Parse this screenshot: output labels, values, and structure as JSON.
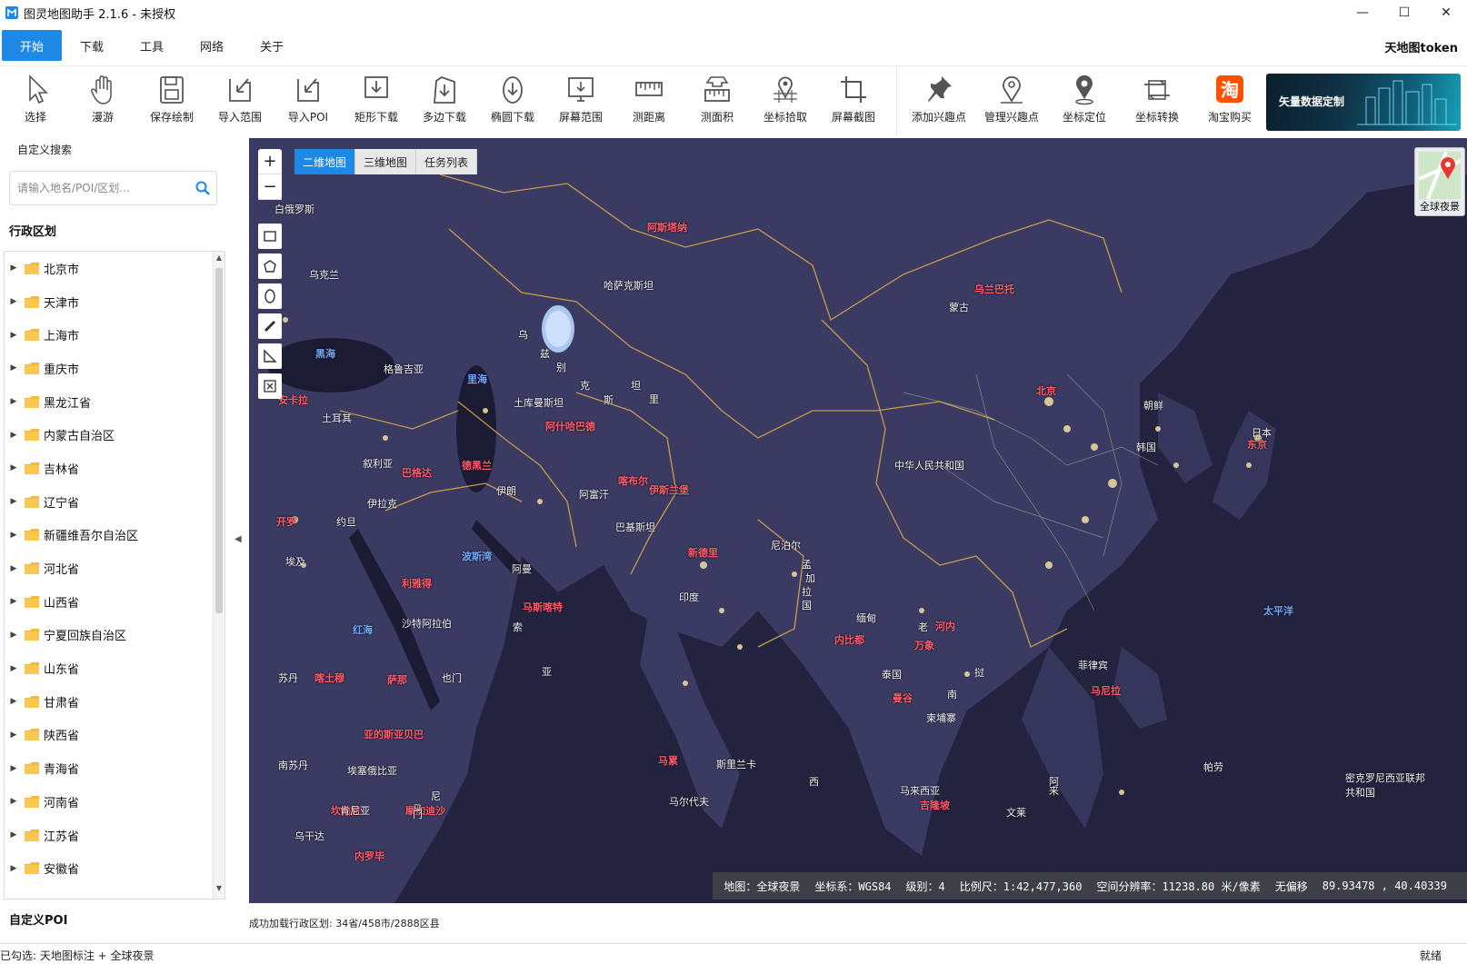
{
  "window": {
    "title": "图灵地图助手  2.1.6 - 未授权",
    "controls": {
      "minimize": "—",
      "maximize": "☐",
      "close": "✕"
    }
  },
  "menu": {
    "items": [
      {
        "label": "开始",
        "active": true
      },
      {
        "label": "下载",
        "active": false
      },
      {
        "label": "工具",
        "active": false
      },
      {
        "label": "网络",
        "active": false
      },
      {
        "label": "关于",
        "active": false
      }
    ],
    "token_link": "天地图token"
  },
  "toolbar": {
    "tools": [
      {
        "label": "选择",
        "icon": "cursor-icon"
      },
      {
        "label": "漫游",
        "icon": "hand-icon"
      },
      {
        "label": "保存绘制",
        "icon": "save-icon"
      },
      {
        "label": "导入范围",
        "icon": "import-range-icon"
      },
      {
        "label": "导入POI",
        "icon": "import-poi-icon"
      },
      {
        "label": "矩形下载",
        "icon": "rect-download-icon"
      },
      {
        "label": "多边下载",
        "icon": "polygon-download-icon"
      },
      {
        "label": "椭圆下载",
        "icon": "ellipse-download-icon"
      },
      {
        "label": "屏幕范围",
        "icon": "screen-range-icon"
      },
      {
        "label": "测距离",
        "icon": "ruler-icon"
      },
      {
        "label": "测面积",
        "icon": "area-icon"
      },
      {
        "label": "坐标拾取",
        "icon": "pick-coord-icon"
      },
      {
        "label": "屏幕截图",
        "icon": "crop-icon"
      },
      {
        "label": "添加兴趣点",
        "icon": "pin-icon"
      },
      {
        "label": "管理兴趣点",
        "icon": "manage-poi-icon"
      },
      {
        "label": "坐标定位",
        "icon": "locate-icon"
      },
      {
        "label": "坐标转换",
        "icon": "convert-icon"
      },
      {
        "label": "淘宝购买",
        "icon": "taobao-icon"
      }
    ],
    "ad_text": "矢量数据定制",
    "taobao_glyph": "淘"
  },
  "sidebar": {
    "search_title": "自定义搜索",
    "search_placeholder": "请输入地名/POI/区划...",
    "admin_header": "行政区划",
    "poi_header": "自定义POI",
    "regions": [
      "北京市",
      "天津市",
      "上海市",
      "重庆市",
      "黑龙江省",
      "内蒙古自治区",
      "吉林省",
      "辽宁省",
      "新疆维吾尔自治区",
      "河北省",
      "山西省",
      "宁夏回族自治区",
      "山东省",
      "甘肃省",
      "陕西省",
      "青海省",
      "河南省",
      "江苏省",
      "安徽省"
    ]
  },
  "map": {
    "tabs": [
      {
        "label": "二维地图",
        "active": true
      },
      {
        "label": "三维地图",
        "active": false
      },
      {
        "label": "任务列表",
        "active": false
      }
    ],
    "zoom_in": "+",
    "zoom_out": "−",
    "layer_switch_label": "全球夜景",
    "labels": [
      {
        "text": "阿斯塔纳",
        "style": "red"
      },
      {
        "text": "哈萨克斯坦",
        "style": "white"
      },
      {
        "text": "乌兰巴托",
        "style": "red"
      },
      {
        "text": "蒙古",
        "style": "white"
      },
      {
        "text": "白俄罗斯",
        "style": "white"
      },
      {
        "text": "乌克兰",
        "style": "white"
      },
      {
        "text": "格鲁吉亚",
        "style": "white"
      },
      {
        "text": "黑海",
        "style": "blue"
      },
      {
        "text": "里海",
        "style": "blue"
      },
      {
        "text": "安卡拉",
        "style": "red"
      },
      {
        "text": "土耳其",
        "style": "white"
      },
      {
        "text": "土库曼斯坦",
        "style": "white"
      },
      {
        "text": "阿什哈巴德",
        "style": "red"
      },
      {
        "text": "叙利亚",
        "style": "white"
      },
      {
        "text": "巴格达",
        "style": "red"
      },
      {
        "text": "德黑兰",
        "style": "red"
      },
      {
        "text": "伊拉克",
        "style": "white"
      },
      {
        "text": "伊朗",
        "style": "white"
      },
      {
        "text": "阿富汗",
        "style": "white"
      },
      {
        "text": "喀布尔",
        "style": "red"
      },
      {
        "text": "伊斯兰堡",
        "style": "red"
      },
      {
        "text": "约旦",
        "style": "white"
      },
      {
        "text": "开罗",
        "style": "red"
      },
      {
        "text": "巴基斯坦",
        "style": "white"
      },
      {
        "text": "埃及",
        "style": "white"
      },
      {
        "text": "波斯湾",
        "style": "blue"
      },
      {
        "text": "阿曼",
        "style": "white"
      },
      {
        "text": "利雅得",
        "style": "red"
      },
      {
        "text": "沙特阿拉伯",
        "style": "white"
      },
      {
        "text": "马斯喀特",
        "style": "red"
      },
      {
        "text": "红海",
        "style": "blue"
      },
      {
        "text": "苏丹",
        "style": "white"
      },
      {
        "text": "喀土穆",
        "style": "red"
      },
      {
        "text": "萨那",
        "style": "red"
      },
      {
        "text": "也门",
        "style": "white"
      },
      {
        "text": "亚的斯亚贝巴",
        "style": "red"
      },
      {
        "text": "埃塞俄比亚",
        "style": "white"
      },
      {
        "text": "南苏丹",
        "style": "white"
      },
      {
        "text": "坎帕拉",
        "style": "red"
      },
      {
        "text": "肯尼亚",
        "style": "white"
      },
      {
        "text": "摩加迪沙",
        "style": "red"
      },
      {
        "text": "乌干达",
        "style": "white"
      },
      {
        "text": "内罗毕",
        "style": "red"
      },
      {
        "text": "北京",
        "style": "red"
      },
      {
        "text": "中华人民共和国",
        "style": "white"
      },
      {
        "text": "朝鲜",
        "style": "white"
      },
      {
        "text": "韩国",
        "style": "white"
      },
      {
        "text": "日本",
        "style": "white"
      },
      {
        "text": "东京",
        "style": "red"
      },
      {
        "text": "新德里",
        "style": "red"
      },
      {
        "text": "尼泊尔",
        "style": "white"
      },
      {
        "text": "印度",
        "style": "white"
      },
      {
        "text": "缅甸",
        "style": "white"
      },
      {
        "text": "内比都",
        "style": "red"
      },
      {
        "text": "河内",
        "style": "red"
      },
      {
        "text": "万象",
        "style": "red"
      },
      {
        "text": "泰国",
        "style": "white"
      },
      {
        "text": "曼谷",
        "style": "red"
      },
      {
        "text": "柬埔寨",
        "style": "white"
      },
      {
        "text": "菲律宾",
        "style": "white"
      },
      {
        "text": "马尼拉",
        "style": "red"
      },
      {
        "text": "马累",
        "style": "red"
      },
      {
        "text": "斯里兰卡",
        "style": "white"
      },
      {
        "text": "马尔代夫",
        "style": "white"
      },
      {
        "text": "马来西亚",
        "style": "white"
      },
      {
        "text": "吉隆坡",
        "style": "red"
      },
      {
        "text": "帕劳",
        "style": "white"
      },
      {
        "text": "太平洋",
        "style": "blue"
      },
      {
        "text": "密克罗尼西亚联邦",
        "style": "white"
      },
      {
        "text": "共和国",
        "style": "white"
      },
      {
        "text": "文莱",
        "style": "white"
      },
      {
        "text": "老",
        "style": "white"
      },
      {
        "text": "挝",
        "style": "white"
      },
      {
        "text": "南",
        "style": "white"
      },
      {
        "text": "孟",
        "style": "white"
      },
      {
        "text": "加",
        "style": "white"
      },
      {
        "text": "拉",
        "style": "white"
      },
      {
        "text": "国",
        "style": "white"
      },
      {
        "text": "乌",
        "style": "white"
      },
      {
        "text": "兹",
        "style": "white"
      },
      {
        "text": "别",
        "style": "white"
      },
      {
        "text": "克",
        "style": "white"
      },
      {
        "text": "斯",
        "style": "white"
      },
      {
        "text": "坦",
        "style": "white"
      },
      {
        "text": "里",
        "style": "white"
      },
      {
        "text": "亚",
        "style": "white"
      },
      {
        "text": "来",
        "style": "white"
      },
      {
        "text": "阿",
        "style": "white"
      },
      {
        "text": "索",
        "style": "white"
      },
      {
        "text": "马",
        "style": "white"
      },
      {
        "text": "尼",
        "style": "white"
      },
      {
        "text": "西",
        "style": "white"
      },
      {
        "text": "门",
        "style": "white"
      }
    ],
    "status": {
      "map_name": "地图：全球夜景",
      "crs": "坐标系：WGS84",
      "level": "级别：4",
      "scale": "比例尺：1:42,477,360",
      "resolution": "空间分辨率：11238.80 米/像素",
      "offset": "无偏移",
      "coords": "89.93478 , 40.40339"
    }
  },
  "status": {
    "load_message": "成功加载行政区划: 34省/458市/2888区县",
    "checked_layers": "已勾选: 天地图标注 + 全球夜景",
    "ready": "就绪"
  },
  "colors": {
    "accent": "#1e88e5",
    "map_bg": "#1a1c3a",
    "capital_label": "#ff5a6a",
    "water_label": "#6ea8ff",
    "border": "#d6a64a"
  }
}
